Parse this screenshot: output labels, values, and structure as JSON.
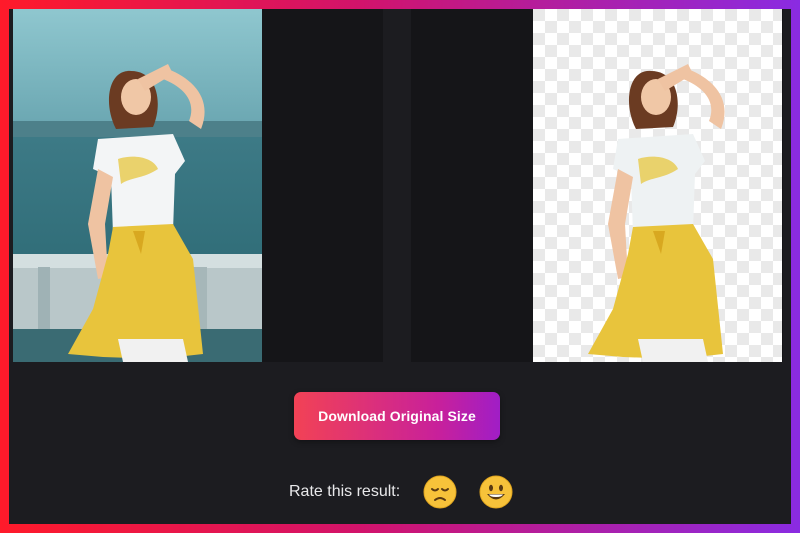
{
  "download": {
    "label": "Download Original Size"
  },
  "rating": {
    "label": "Rate this result:",
    "options": [
      {
        "name": "sad-face-icon",
        "emoji": "😔"
      },
      {
        "name": "grinning-face-icon",
        "emoji": "😀"
      }
    ]
  }
}
